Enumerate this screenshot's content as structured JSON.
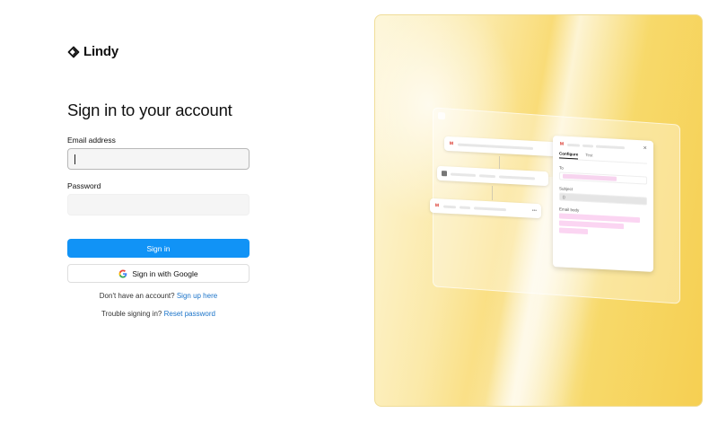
{
  "brand": {
    "name": "Lindy"
  },
  "form": {
    "title": "Sign in to your account",
    "email_label": "Email address",
    "email_value": "",
    "password_label": "Password",
    "password_value": "",
    "signin_label": "Sign in",
    "google_label": "Sign in with Google"
  },
  "footer": {
    "signup_prompt": "Don't have an account?",
    "signup_link": "Sign up here",
    "reset_prompt": "Trouble signing in?",
    "reset_link": "Reset password"
  },
  "illustration": {
    "panel": {
      "tabs": [
        "Configure",
        "Test"
      ],
      "to_label": "To",
      "subject_label": "Subject",
      "email_body_label": "Email body"
    },
    "icons": [
      "gmail-icon",
      "grid-icon",
      "more-icon",
      "close-icon",
      "sparkle-icon"
    ]
  },
  "colors": {
    "primary": "#1193f6",
    "link": "#1a73c9",
    "hero_yellow": "#f6cf52"
  }
}
